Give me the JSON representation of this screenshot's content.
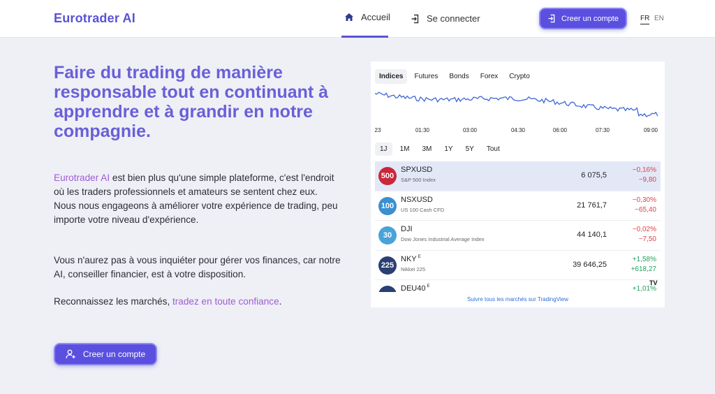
{
  "header": {
    "logo": "Eurotrader AI",
    "nav": {
      "home": "Accueil",
      "login": "Se connecter"
    },
    "cta": "Creer un compte",
    "lang_fr": "FR",
    "lang_en": "EN"
  },
  "hero": {
    "title": "Faire du trading de manière responsable tout en continuant à apprendre et à grandir en notre compagnie.",
    "p1_brand": "Eurotrader AI",
    "p1_rest": " est bien plus qu'une simple plateforme, c'est l'endroit où les traders professionnels et amateurs se sentent chez eux.",
    "p1_line2": "Nous nous engageons à améliorer votre expérience de trading, peu importe votre niveau d'expérience.",
    "p2": "Vous n'aurez pas à vous inquiéter pour gérer vos finances, car notre AI, conseiller financier, est à votre disposition.",
    "p3_start": "Reconnaissez les marchés, ",
    "p3_accent": "tradez en toute confiance",
    "p3_end": ".",
    "cta": "Creer un compte"
  },
  "widget": {
    "tabs": [
      "Indices",
      "Futures",
      "Bonds",
      "Forex",
      "Crypto"
    ],
    "active_tab": "Indices",
    "x_ticks": [
      "23",
      "01:30",
      "03:00",
      "04:30",
      "06:00",
      "07:30",
      "09:00"
    ],
    "ranges": [
      "1J",
      "1M",
      "3M",
      "1Y",
      "5Y",
      "Tout"
    ],
    "active_range": "1J",
    "rows": [
      {
        "badge": "500",
        "badge_color": "#c8283a",
        "symbol": "SPXUSD",
        "sup": "",
        "desc": "S&P 500 Index",
        "price": "6 075,5",
        "pct": "−0,16%",
        "abs": "−9,80",
        "dir": "neg"
      },
      {
        "badge": "100",
        "badge_color": "#3b8fd0",
        "symbol": "NSXUSD",
        "sup": "",
        "desc": "US 100 Cash CFD",
        "price": "21 761,7",
        "pct": "−0,30%",
        "abs": "−65,40",
        "dir": "neg"
      },
      {
        "badge": "30",
        "badge_color": "#4aa3d8",
        "symbol": "DJI",
        "sup": "",
        "desc": "Dow Jones Industrial Average Index",
        "price": "44 140,1",
        "pct": "−0,02%",
        "abs": "−7,50",
        "dir": "neg"
      },
      {
        "badge": "225",
        "badge_color": "#2a3f73",
        "symbol": "NKY",
        "sup": "E",
        "desc": "Nikkei 225",
        "price": "39 646,25",
        "pct": "+1,58%",
        "abs": "+618,27",
        "dir": "pos"
      },
      {
        "badge": "",
        "badge_color": "#2a3f73",
        "symbol": "DEU40",
        "sup": "E",
        "desc": "",
        "price": "",
        "pct": "+1,01%",
        "abs": "",
        "dir": "pos"
      }
    ],
    "footer_link": "Suivre tous les marchés sur TradingView",
    "tv_logo": "TV",
    "line_color": "#3d67d6"
  }
}
